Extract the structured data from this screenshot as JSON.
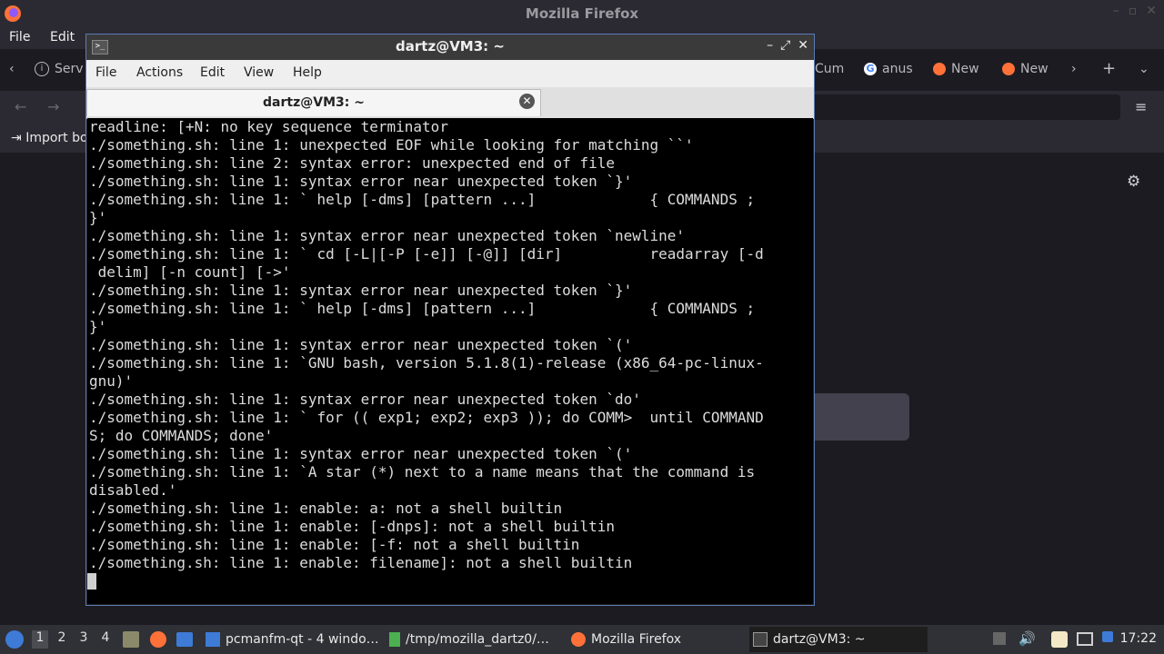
{
  "firefox": {
    "title": "Mozilla Firefox",
    "menu": [
      "File",
      "Edit"
    ],
    "tabs": [
      "Serv",
      "Cum",
      "anus",
      "New",
      "New"
    ],
    "bookmark_label": "Import bo"
  },
  "terminal": {
    "title": "dartz@VM3: ~",
    "menu": [
      "File",
      "Actions",
      "Edit",
      "View",
      "Help"
    ],
    "tab_label": "dartz@VM3: ~",
    "lines": [
      "readline: [+N: no key sequence terminator",
      "./something.sh: line 1: unexpected EOF while looking for matching ``'",
      "./something.sh: line 2: syntax error: unexpected end of file",
      "./something.sh: line 1: syntax error near unexpected token `}'",
      "./something.sh: line 1: ` help [-dms] [pattern ...]             { COMMANDS ;",
      "}'",
      "./something.sh: line 1: syntax error near unexpected token `newline'",
      "./something.sh: line 1: ` cd [-L|[-P [-e]] [-@]] [dir]          readarray [-d",
      " delim] [-n count] [->'",
      "./something.sh: line 1: syntax error near unexpected token `}'",
      "./something.sh: line 1: ` help [-dms] [pattern ...]             { COMMANDS ;",
      "}'",
      "./something.sh: line 1: syntax error near unexpected token `('",
      "./something.sh: line 1: `GNU bash, version 5.1.8(1)-release (x86_64-pc-linux-",
      "gnu)'",
      "./something.sh: line 1: syntax error near unexpected token `do'",
      "./something.sh: line 1: ` for (( exp1; exp2; exp3 )); do COMM>  until COMMAND",
      "S; do COMMANDS; done'",
      "./something.sh: line 1: syntax error near unexpected token `('",
      "./something.sh: line 1: `A star (*) next to a name means that the command is",
      "disabled.'",
      "./something.sh: line 1: enable: a: not a shell builtin",
      "./something.sh: line 1: enable: [-dnps]: not a shell builtin",
      "./something.sh: line 1: enable: [-f: not a shell builtin",
      "./something.sh: line 1: enable: filename]: not a shell builtin"
    ]
  },
  "taskbar": {
    "desktops": [
      "1",
      "2",
      "3",
      "4"
    ],
    "tasks": [
      {
        "label": "pcmanfm-qt - 4 windo…",
        "icon": "folder-icon"
      },
      {
        "label": "/tmp/mozilla_dartz0/…",
        "icon": "archive-icon"
      },
      {
        "label": "Mozilla Firefox",
        "icon": "firefox-icon"
      },
      {
        "label": "dartz@VM3: ~",
        "icon": "terminal-icon"
      }
    ],
    "clock": "17:22"
  },
  "colors": {
    "terminal_bg": "#000000",
    "terminal_fg": "#dcdcdc",
    "firefox_dark": "#1c1b22",
    "taskbar": "#2f3136"
  }
}
